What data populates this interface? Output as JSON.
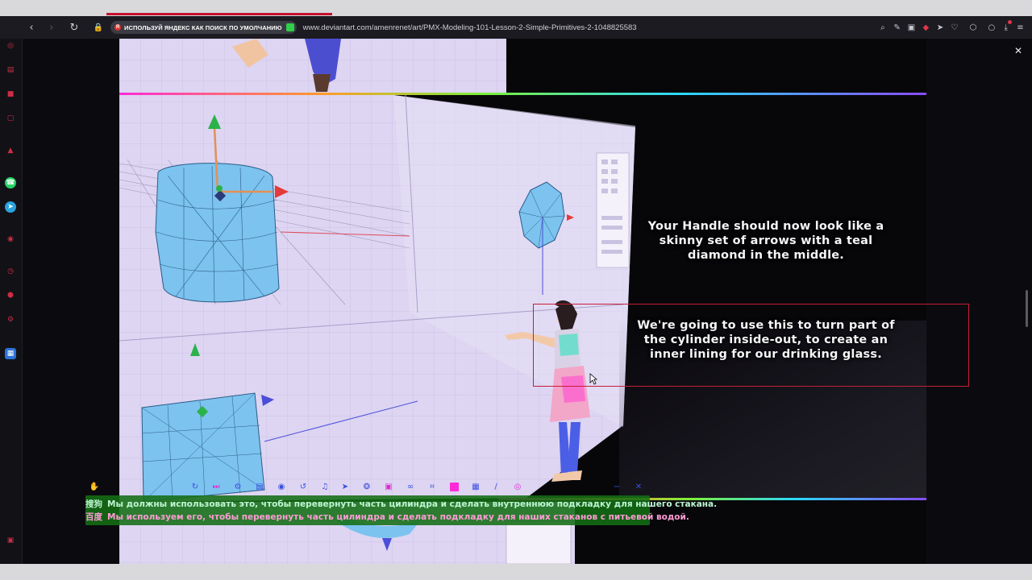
{
  "browser": {
    "promo_text": "ИСПОЛЬЗУЙ ЯНДЕКС КАК ПОИСК ПО УМОЛЧАНИЮ",
    "url": "www.deviantart.com/amenrenet/art/PMX-Modeling-101-Lesson-2-Simple-Primitives-2-1048825583"
  },
  "captions": {
    "line1": "Your Handle should now look like a skinny set of arrows with a teal diamond in the middle.",
    "line2": "We're going to use this to turn part of the cylinder inside-out, to create an inner lining for our drinking glass."
  },
  "translation": {
    "engine1": "搜狗",
    "text1": "Мы должны использовать это, чтобы перевернуть часть цилиндра и сделать внутреннюю подкладку для нашего стакана.",
    "engine2": "百度",
    "text2": "Мы используем его, чтобы перевернуть часть цилиндра и сделать подкладку для наших стаканов с питьевой водой."
  },
  "colors": {
    "accent_red": "#c41e3a",
    "overlay_green": "#146e14",
    "mesh_blue": "#7cc3ef",
    "grid_lilac": "#ddd5f2"
  },
  "icons": {
    "sidebar": [
      "speed-dial-icon",
      "shopping-bag-icon",
      "twitch-icon",
      "instagram-icon",
      "aria-icon",
      "whatsapp-icon",
      "telegram-icon",
      "player-icon",
      "history-icon",
      "cube-icon",
      "settings-icon",
      "apps-icon",
      "gallery-icon"
    ],
    "toolbar": [
      "search-icon",
      "edit-icon",
      "camera-icon",
      "shield-icon",
      "send-icon",
      "heart-icon",
      "box-icon",
      "profile-icon",
      "download-icon",
      "menu-icon"
    ]
  }
}
